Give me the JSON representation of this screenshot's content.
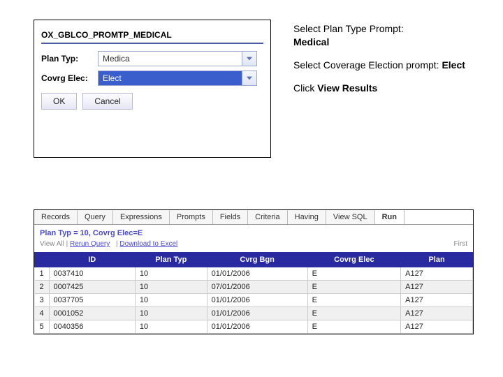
{
  "dialog": {
    "title": "OX_GBLCO_PROMTP_MEDICAL",
    "plan_type_label": "Plan Typ:",
    "plan_type_value": "Medica",
    "covrg_elec_label": "Covrg Elec:",
    "covrg_elec_value": "Elect",
    "ok_label": "OK",
    "cancel_label": "Cancel"
  },
  "instructions": {
    "line1a": "Select Plan Type Prompt:",
    "line1b": "Medical",
    "line2a": "Select Coverage Election prompt: ",
    "line2b": "Elect",
    "line3a": "Click ",
    "line3b": "View Results"
  },
  "results": {
    "tabs": [
      "Records",
      "Query",
      "Expressions",
      "Prompts",
      "Fields",
      "Criteria",
      "Having",
      "View SQL",
      "Run"
    ],
    "active_tab": 8,
    "summary": "Plan Typ = 10, Covrg Elec=E",
    "view_all": "View All",
    "rerun": "Rerun Query",
    "download": "Download to Excel",
    "first": "First",
    "columns": [
      "ID",
      "Plan Typ",
      "Cvrg Bgn",
      "Covrg Elec",
      "Plan"
    ],
    "rows": [
      {
        "n": "1",
        "id": "0037410",
        "pt": "10",
        "cb": "01/01/2006",
        "ce": "E",
        "plan": "A127"
      },
      {
        "n": "2",
        "id": "0007425",
        "pt": "10",
        "cb": "07/01/2006",
        "ce": "E",
        "plan": "A127"
      },
      {
        "n": "3",
        "id": "0037705",
        "pt": "10",
        "cb": "01/01/2006",
        "ce": "E",
        "plan": "A127"
      },
      {
        "n": "4",
        "id": "0001052",
        "pt": "10",
        "cb": "01/01/2006",
        "ce": "E",
        "plan": "A127"
      },
      {
        "n": "5",
        "id": "0040356",
        "pt": "10",
        "cb": "01/01/2006",
        "ce": "E",
        "plan": "A127"
      }
    ]
  }
}
